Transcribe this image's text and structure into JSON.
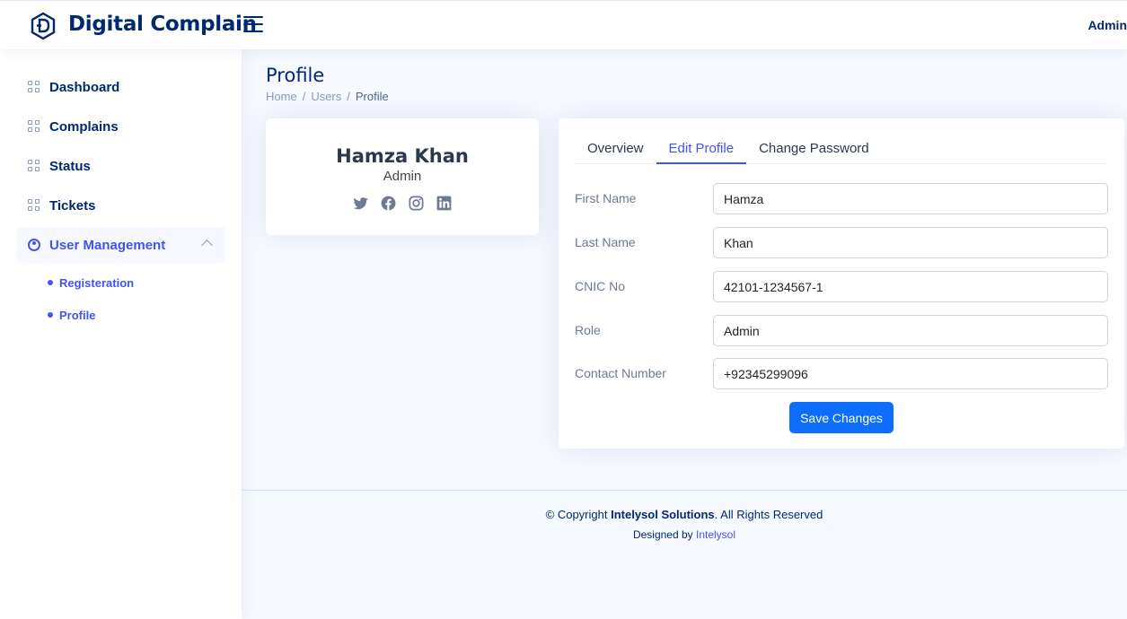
{
  "header": {
    "brand": "Digital Complain",
    "user_label": "Admin"
  },
  "sidebar": {
    "items": [
      {
        "label": "Dashboard",
        "icon": "grid-icon"
      },
      {
        "label": "Complains",
        "icon": "grid-icon"
      },
      {
        "label": "Status",
        "icon": "grid-icon"
      },
      {
        "label": "Tickets",
        "icon": "grid-icon"
      },
      {
        "label": "User Management",
        "icon": "person-circle-icon"
      }
    ],
    "subitems": [
      {
        "label": "Registeration"
      },
      {
        "label": "Profile"
      }
    ]
  },
  "page": {
    "title": "Profile",
    "breadcrumb": [
      "Home",
      "Users",
      "Profile"
    ]
  },
  "profile_card": {
    "name": "Hamza Khan",
    "role": "Admin",
    "socials": [
      "twitter-icon",
      "facebook-icon",
      "instagram-icon",
      "linkedin-icon"
    ]
  },
  "tabs": [
    "Overview",
    "Edit Profile",
    "Change Password"
  ],
  "form": {
    "fields": [
      {
        "label": "First Name",
        "value": "Hamza"
      },
      {
        "label": "Last Name",
        "value": "Khan"
      },
      {
        "label": "CNIC No",
        "value": "42101-1234567-1"
      },
      {
        "label": "Role",
        "value": "Admin"
      },
      {
        "label": "Contact Number",
        "value": "+92345299096"
      }
    ],
    "save_label": "Save Changes"
  },
  "footer": {
    "copyright_prefix": "© Copyright ",
    "company": "Intelysol Solutions",
    "copyright_suffix": ". All Rights Reserved",
    "designed_prefix": "Designed by ",
    "designer": "Intelysol"
  },
  "colors": {
    "primary": "#4154f1",
    "navy": "#012970",
    "button": "#0d6efd",
    "background": "#f6f9ff"
  }
}
